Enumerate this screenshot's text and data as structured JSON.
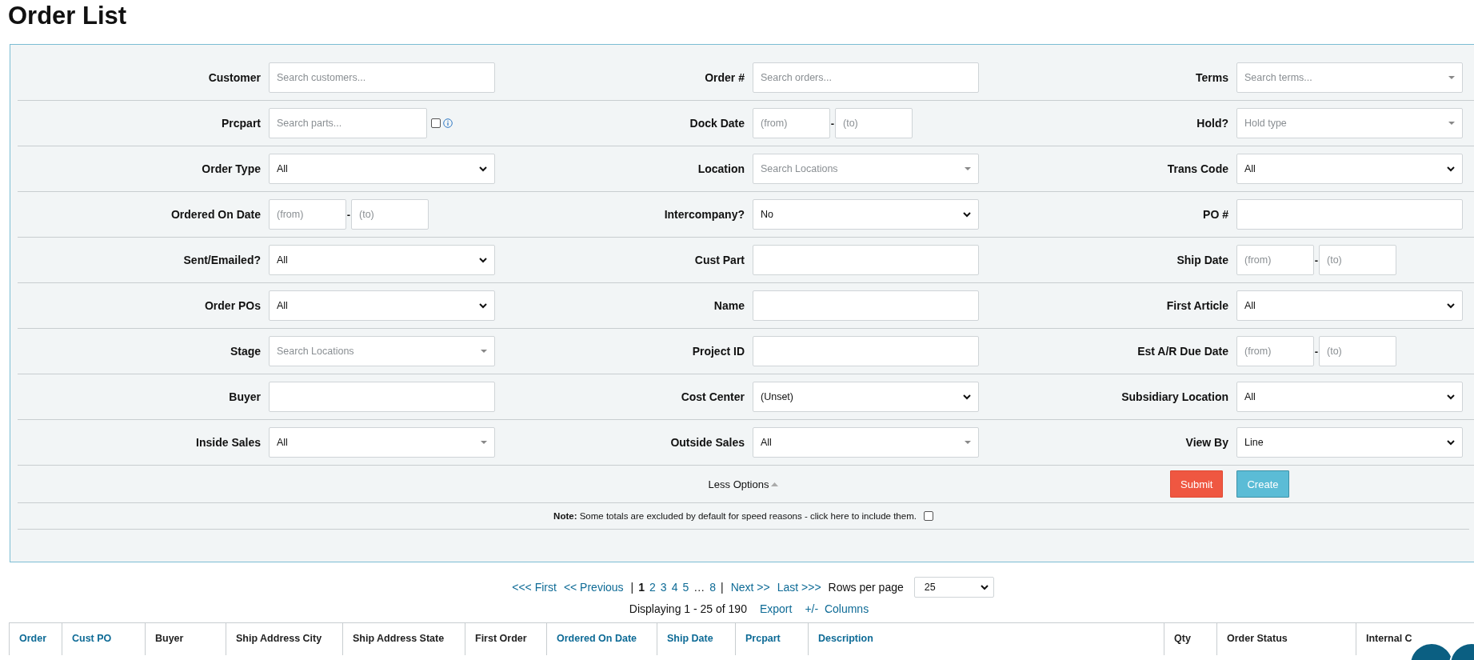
{
  "title": "Order List",
  "filter_rows": [
    {
      "fields": [
        {
          "label": "Customer",
          "kind": "text",
          "placeholder": "Search customers..."
        },
        {
          "label": "Order #",
          "kind": "text",
          "placeholder": "Search orders..."
        },
        {
          "label": "Terms",
          "kind": "combo",
          "placeholder": "Search terms..."
        }
      ]
    },
    {
      "fields": [
        {
          "label": "Prcpart",
          "kind": "part",
          "placeholder": "Search parts...",
          "checked": false
        },
        {
          "label": "Dock Date",
          "kind": "date_range",
          "from_placeholder": "(from)",
          "to_placeholder": "(to)",
          "separator": "-"
        },
        {
          "label": "Hold?",
          "kind": "combo",
          "placeholder": "Hold type"
        }
      ]
    },
    {
      "fields": [
        {
          "label": "Order Type",
          "kind": "select",
          "value": "All"
        },
        {
          "label": "Location",
          "kind": "combo",
          "placeholder": "Search Locations"
        },
        {
          "label": "Trans Code",
          "kind": "select",
          "value": "All"
        }
      ]
    },
    {
      "fields": [
        {
          "label": "Ordered On Date",
          "kind": "date_range",
          "from_placeholder": "(from)",
          "to_placeholder": "(to)",
          "separator": "-"
        },
        {
          "label": "Intercompany?",
          "kind": "select",
          "value": "No"
        },
        {
          "label": "PO #",
          "kind": "text"
        }
      ]
    },
    {
      "fields": [
        {
          "label": "Sent/Emailed?",
          "kind": "select",
          "value": "All"
        },
        {
          "label": "Cust Part",
          "kind": "text"
        },
        {
          "label": "Ship Date",
          "kind": "date_range",
          "from_placeholder": "(from)",
          "to_placeholder": "(to)",
          "separator": "-"
        }
      ]
    },
    {
      "fields": [
        {
          "label": "Order POs",
          "kind": "select",
          "value": "All"
        },
        {
          "label": "Name",
          "kind": "text"
        },
        {
          "label": "First Article",
          "kind": "select",
          "value": "All"
        }
      ]
    },
    {
      "fields": [
        {
          "label": "Stage",
          "kind": "combo",
          "placeholder": "Search Locations"
        },
        {
          "label": "Project ID",
          "kind": "text"
        },
        {
          "label": "Est A/R Due Date",
          "kind": "date_range",
          "from_placeholder": "(from)",
          "to_placeholder": "(to)",
          "separator": "-"
        }
      ]
    },
    {
      "fields": [
        {
          "label": "Buyer",
          "kind": "text"
        },
        {
          "label": "Cost Center",
          "kind": "select",
          "value": "(Unset)"
        },
        {
          "label": "Subsidiary Location",
          "kind": "select",
          "value": "All"
        }
      ]
    },
    {
      "fields": [
        {
          "label": "Inside Sales",
          "kind": "combo",
          "value": "All"
        },
        {
          "label": "Outside Sales",
          "kind": "combo",
          "value": "All"
        },
        {
          "label": "View By",
          "kind": "select",
          "value": "Line"
        }
      ]
    }
  ],
  "options_toggle": "Less Options",
  "buttons": [
    {
      "label": "Submit",
      "kind": "primary"
    },
    {
      "label": "Create",
      "kind": "info"
    }
  ],
  "note": {
    "text": "**Note:** Some totals are excluded by default for speed reasons - click here to include them.",
    "checked": false
  },
  "pagination": {
    "first": "<<< First",
    "previous": "<< Previous",
    "pipe_left": "|",
    "pages": [
      {
        "label": "1",
        "selected": true
      },
      {
        "label": "2",
        "selected": false
      },
      {
        "label": "3",
        "selected": false
      },
      {
        "label": "4",
        "selected": false
      },
      {
        "label": "5",
        "selected": false
      }
    ],
    "ellipsis": "…",
    "last_page": "8",
    "pipe_right": "|",
    "next": "Next >>",
    "last": "Last >>>",
    "rows_label": "Rows per page",
    "rows_value": "25"
  },
  "summary": {
    "text": "Displaying 1 - 25 of 190",
    "export": "Export",
    "columns_toggle": "+/-  Columns"
  },
  "table": {
    "columns": [
      {
        "label": "Order",
        "sortable": true
      },
      {
        "label": "Cust PO",
        "sortable": true
      },
      {
        "label": "Buyer",
        "sortable": false
      },
      {
        "label": "Ship Address City",
        "sortable": false
      },
      {
        "label": "Ship Address State",
        "sortable": false
      },
      {
        "label": "First Order",
        "sortable": false
      },
      {
        "label": "Ordered On Date",
        "sortable": true
      },
      {
        "label": "Ship Date",
        "sortable": true
      },
      {
        "label": "Prcpart",
        "sortable": true
      },
      {
        "label": "Description",
        "sortable": true
      },
      {
        "label": "Qty",
        "sortable": false
      },
      {
        "label": "Order Status",
        "sortable": false
      },
      {
        "label": "Internal C",
        "sortable": false
      }
    ]
  }
}
